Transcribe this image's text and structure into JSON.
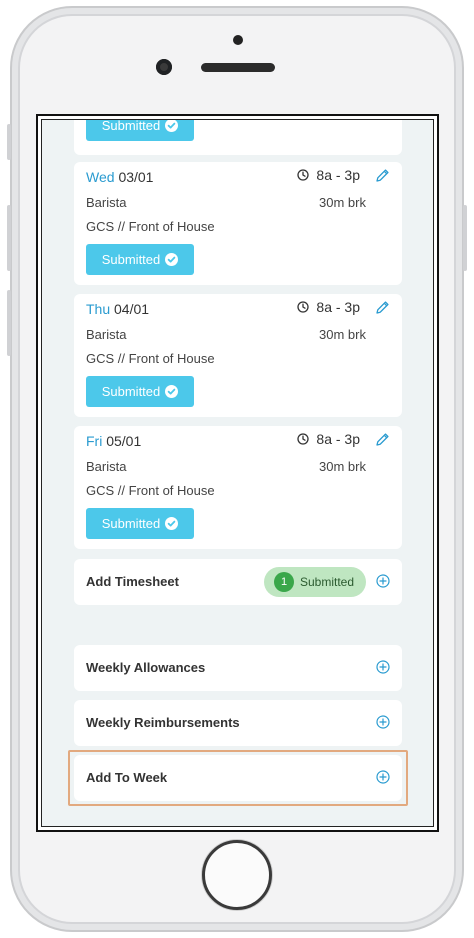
{
  "shifts": [
    {
      "day": "Wed",
      "date": "03/01",
      "time": "8a - 3p",
      "role": "Barista",
      "break": "30m brk",
      "location": "GCS // Front of House",
      "status": "Submitted"
    },
    {
      "day": "Thu",
      "date": "04/01",
      "time": "8a - 3p",
      "role": "Barista",
      "break": "30m brk",
      "location": "GCS // Front of House",
      "status": "Submitted"
    },
    {
      "day": "Fri",
      "date": "05/01",
      "time": "8a - 3p",
      "role": "Barista",
      "break": "30m brk",
      "location": "GCS // Front of House",
      "status": "Submitted"
    }
  ],
  "previous_status": "Submitted",
  "add_timesheet": {
    "label": "Add Timesheet",
    "badge_count": "1",
    "badge_label": "Submitted"
  },
  "weekly_allowances": {
    "label": "Weekly Allowances"
  },
  "weekly_reimbursements": {
    "label": "Weekly Reimbursements"
  },
  "add_to_week": {
    "label": "Add To Week"
  },
  "colors": {
    "accent": "#2a9bd0",
    "submitted_button": "#4cc8ea",
    "badge_bg": "#bfe6c1",
    "badge_dot": "#3aa74a",
    "highlight": "#e2a97f"
  },
  "icons": {
    "clock": "clock-icon",
    "edit": "pencil-icon",
    "check": "check-circle-icon",
    "add": "plus-circle-icon"
  }
}
